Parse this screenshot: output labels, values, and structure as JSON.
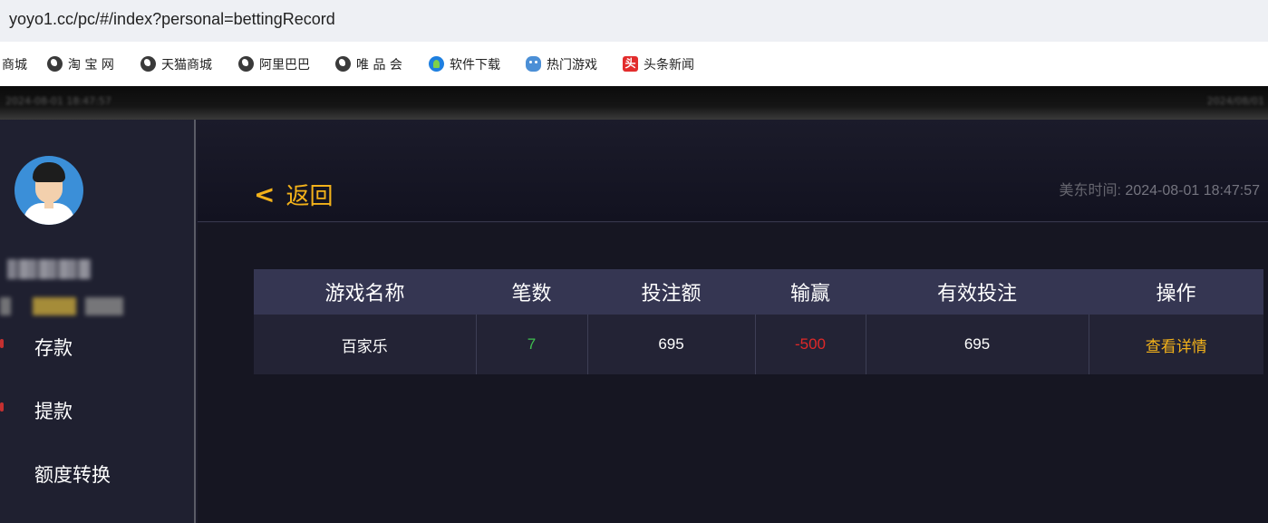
{
  "browser": {
    "url": "yoyo1.cc/pc/#/index?personal=bettingRecord",
    "bookmarks": [
      {
        "label": "商城",
        "icon": "none"
      },
      {
        "label": "淘 宝 网",
        "icon": "globe-icon"
      },
      {
        "label": "天猫商城",
        "icon": "globe-icon"
      },
      {
        "label": "阿里巴巴",
        "icon": "globe-icon"
      },
      {
        "label": "唯 品 会",
        "icon": "globe-icon"
      },
      {
        "label": "软件下载",
        "icon": "software-download-icon"
      },
      {
        "label": "热门游戏",
        "icon": "game-icon"
      },
      {
        "label": "头条新闻",
        "icon": "news-icon",
        "icon_text": "头"
      }
    ]
  },
  "topbar": {
    "left_text": "2024-08-01 18:47:57",
    "right_text": "2024/08/01"
  },
  "sidebar": {
    "username": "",
    "balance": "",
    "menu": [
      {
        "label": "存款"
      },
      {
        "label": "提款"
      },
      {
        "label": "额度转换"
      }
    ]
  },
  "header": {
    "back_label": "返回",
    "back_icon": "<",
    "time_label": "美东时间:",
    "time_value": "2024-08-01 18:47:57"
  },
  "table": {
    "columns": [
      "游戏名称",
      "笔数",
      "投注额",
      "输赢",
      "有效投注",
      "操作"
    ],
    "rows": [
      {
        "game": "百家乐",
        "count": "7",
        "bet": "695",
        "win_loss": "-500",
        "valid_bet": "695",
        "action": "查看详情"
      }
    ]
  },
  "colors": {
    "accent": "#f3b21a",
    "positive": "#3fbf4f",
    "negative": "#e02828",
    "header_row": "#353652",
    "body_row": "#232335"
  }
}
